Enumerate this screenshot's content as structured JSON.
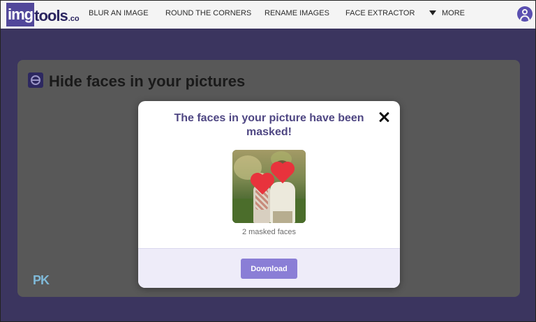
{
  "header": {
    "logo": {
      "box": "img",
      "rest": "tools",
      "tld": ".co"
    },
    "nav": [
      {
        "label": "BLUR AN IMAGE"
      },
      {
        "label": "ROUND THE CORNERS"
      },
      {
        "label": "RENAME IMAGES"
      },
      {
        "label": "FACE EXTRACTOR"
      },
      {
        "label": "MORE"
      }
    ],
    "avatar_icon": "user-icon"
  },
  "card": {
    "title": "Hide faces in your pictures",
    "icon": "face-mask-icon"
  },
  "watermark": {
    "text": "PK"
  },
  "modal": {
    "title": "The faces in your picture have been masked!",
    "close_icon": "close-icon",
    "masked_count_label": "2 masked faces",
    "download_label": "Download"
  },
  "colors": {
    "accent": "#8a7ed6",
    "title": "#4f4783",
    "heart": "#e8333c",
    "brand": "#51479a"
  }
}
